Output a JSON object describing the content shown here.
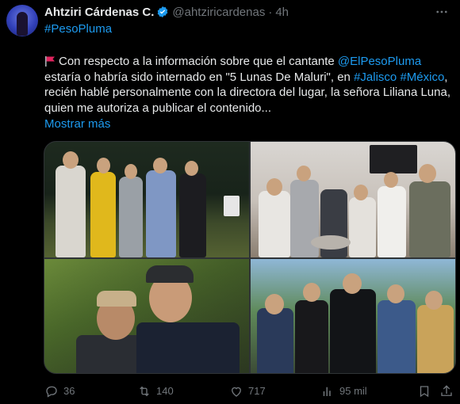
{
  "author": {
    "name": "Ahtziri Cárdenas C.",
    "handle": "@ahtziricardenas",
    "separator": "·",
    "time": "4h"
  },
  "hashtag": "#PesoPluma",
  "body": {
    "p1": "Con respecto a la información sobre que el cantante ",
    "mention": "@ElPesoPluma",
    "p2": " estaría o habría sido internado en \"5 Lunas De Maluri\", en ",
    "tag1": "#Jalisco",
    "space": " ",
    "tag2": "#México",
    "p3": ", recién  hablé personalmente con la directora del lugar,  la señora Liliana Luna, quien me autoriza a publicar el contenido..."
  },
  "show_more": "Mostrar más",
  "actions": {
    "replies": "36",
    "reposts": "140",
    "likes": "717",
    "views": "95 mil"
  },
  "colors": {
    "accent": "#1d9bf0",
    "muted": "#71767b",
    "text": "#e7e9ea",
    "background": "#000000"
  },
  "icons": [
    "more-icon",
    "verified-icon",
    "red-flag-icon",
    "reply-icon",
    "repost-icon",
    "like-icon",
    "views-icon",
    "bookmark-icon",
    "share-icon"
  ]
}
